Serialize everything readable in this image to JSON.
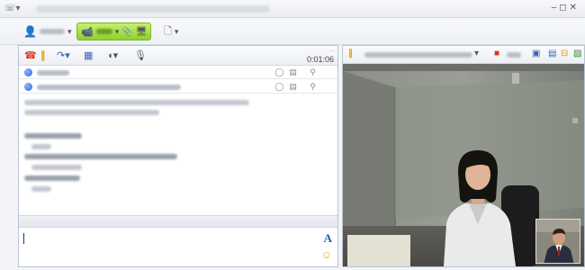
{
  "timer": {
    "label": "0:01:06"
  },
  "colors": {
    "accent_green": "#9ad83a",
    "hangup_red": "#d9341f",
    "video_wall": "#7d8178"
  },
  "toolbar": {
    "icons": [
      "user-status-icon",
      "video-call-icon",
      "attach-icon",
      "document-icon"
    ]
  },
  "participants": {
    "count": 2
  },
  "composer": {
    "font_glyph": "A"
  }
}
